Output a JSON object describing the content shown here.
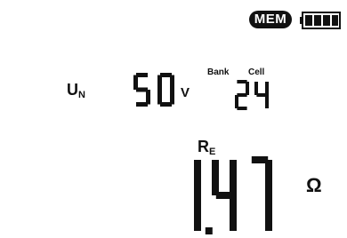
{
  "status": {
    "memory_badge": "MEM"
  },
  "battery": {
    "level_fraction": 1.0,
    "segments": 4
  },
  "voltage": {
    "symbol": "U",
    "subscript": "N",
    "value": "50",
    "unit": "V"
  },
  "memory": {
    "bank_label": "Bank",
    "cell_label": "Cell",
    "cell_value": "24"
  },
  "resistance": {
    "symbol": "R",
    "subscript": "E",
    "value": "1.47",
    "unit": "Ω"
  }
}
